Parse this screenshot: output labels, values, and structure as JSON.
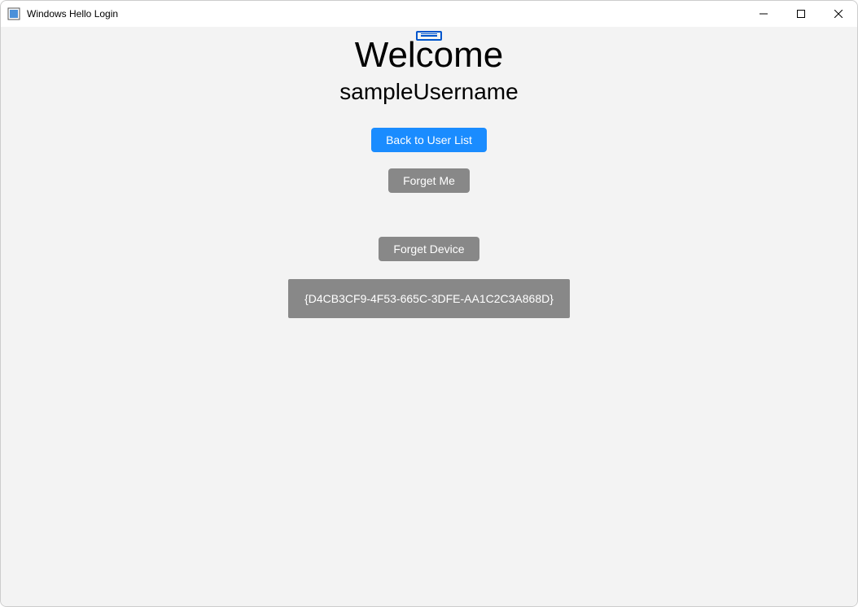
{
  "window": {
    "title": "Windows Hello Login"
  },
  "content": {
    "welcome_heading": "Welcome",
    "username": "sampleUsername",
    "back_button_label": "Back to User List",
    "forget_me_label": "Forget Me",
    "forget_device_label": "Forget Device",
    "device_id": "{D4CB3CF9-4F53-665C-3DFE-AA1C2C3A868D}"
  }
}
